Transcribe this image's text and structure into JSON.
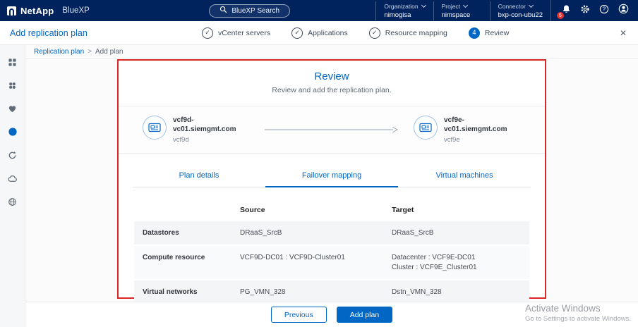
{
  "topbar": {
    "brand": "NetApp",
    "product": "BlueXP",
    "search_label": "BlueXP Search",
    "organization": {
      "label": "Organization",
      "value": "nimogisa"
    },
    "project": {
      "label": "Project",
      "value": "nimspace"
    },
    "connector": {
      "label": "Connector",
      "value": "bxp-con-ubu22"
    },
    "notification_count": "5",
    "help_glyph": "?"
  },
  "wizard": {
    "title": "Add replication plan",
    "check_glyph": "✓",
    "close_glyph": "✕",
    "steps": [
      {
        "label": "vCenter servers"
      },
      {
        "label": "Applications"
      },
      {
        "label": "Resource mapping"
      },
      {
        "label": "Review",
        "number": "4"
      }
    ]
  },
  "breadcrumb": {
    "parent": "Replication plan",
    "separator": ">",
    "current": "Add plan"
  },
  "review": {
    "title": "Review",
    "subtitle": "Review and add the replication plan.",
    "source_vcenter": {
      "name": "vcf9d-vc01.siemgmt.com",
      "id": "vcf9d"
    },
    "target_vcenter": {
      "name": "vcf9e-vc01.siemgmt.com",
      "id": "vcf9e"
    },
    "tabs": [
      {
        "label": "Plan details"
      },
      {
        "label": "Failover mapping"
      },
      {
        "label": "Virtual machines"
      }
    ],
    "table": {
      "col_source": "Source",
      "col_target": "Target",
      "rows": [
        {
          "label": "Datastores",
          "source": "DRaaS_SrcB",
          "target_line1": "DRaaS_SrcB",
          "target_line2": ""
        },
        {
          "label": "Compute resource",
          "source": "VCF9D-DC01 : VCF9D-Cluster01",
          "target_line1": "Datacenter : VCF9E-DC01",
          "target_line2": "Cluster : VCF9E_Cluster01"
        },
        {
          "label": "Virtual networks",
          "source": "PG_VMN_328",
          "target_line1": "Dstn_VMN_328",
          "target_line2": ""
        }
      ]
    }
  },
  "footer": {
    "previous": "Previous",
    "add_plan": "Add plan"
  },
  "watermark": {
    "title": "Activate Windows",
    "subtitle": "Go to Settings to activate Windows."
  }
}
